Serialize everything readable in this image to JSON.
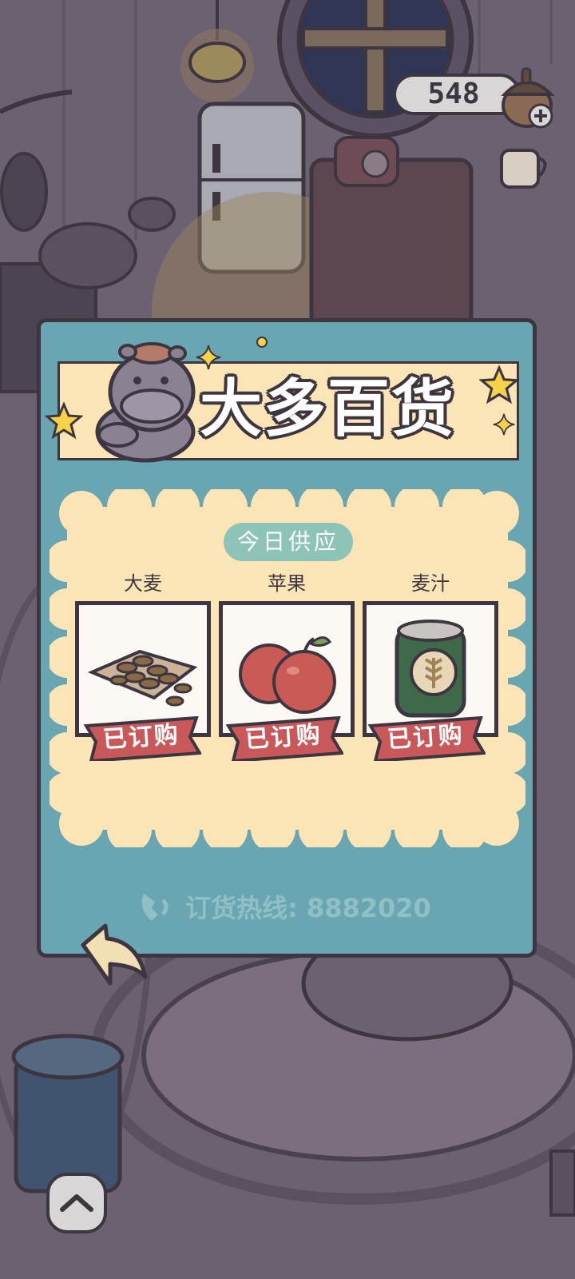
{
  "currency": {
    "amount": "548",
    "icon": "acorn-icon",
    "add_icon": "plus-icon"
  },
  "shop": {
    "title": "大多百货",
    "mascot_icon": "hippo-mascot-icon",
    "supply_header": "今日供应",
    "items": [
      {
        "name": "大麦",
        "icon": "barley-icon",
        "status": "已订购"
      },
      {
        "name": "苹果",
        "icon": "apple-icon",
        "status": "已订购"
      },
      {
        "name": "麦汁",
        "icon": "wort-can-icon",
        "status": "已订购"
      }
    ],
    "hotline": "订货热线: 8882020"
  },
  "colors": {
    "panel": "#6aa6b2",
    "banner": "#fbe4b6",
    "tag": "#c9585a",
    "outline": "#3d3640"
  }
}
